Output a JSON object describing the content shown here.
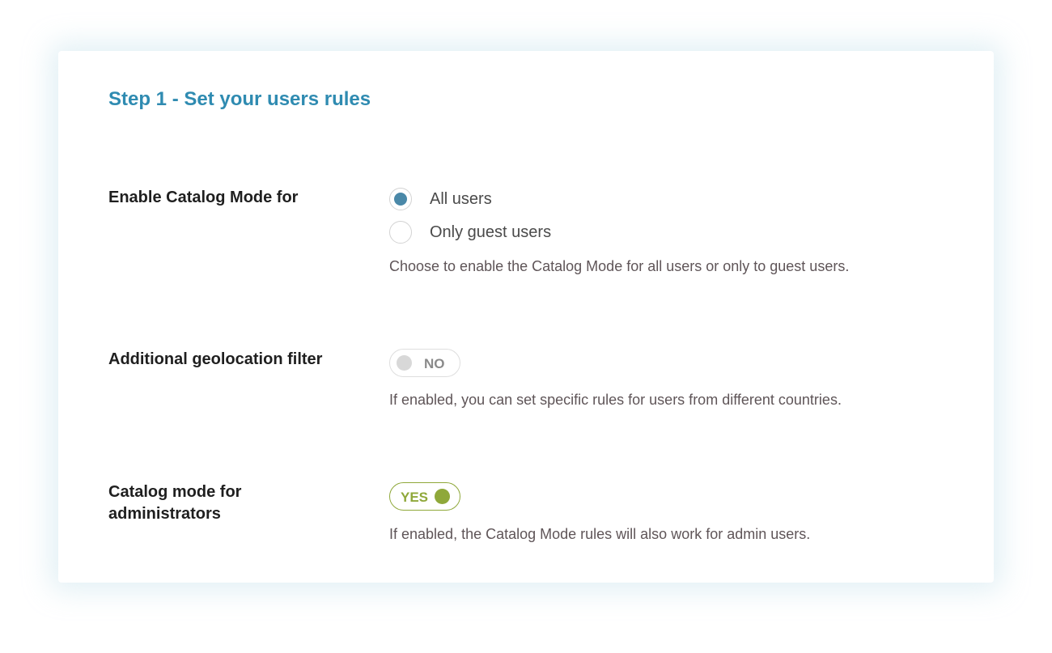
{
  "section": {
    "title": "Step 1 - Set your users rules"
  },
  "rows": {
    "catalog_mode_for": {
      "label": "Enable Catalog Mode for",
      "options": [
        {
          "label": "All users",
          "checked": true
        },
        {
          "label": "Only guest users",
          "checked": false
        }
      ],
      "help": "Choose to enable the Catalog Mode for all users or only to guest users."
    },
    "geolocation": {
      "label": "Additional geolocation filter",
      "toggle_state": "NO",
      "enabled": false,
      "help": "If enabled, you can set specific rules for users from different countries."
    },
    "administrators": {
      "label_line1": "Catalog mode for",
      "label_line2": "administrators",
      "toggle_state": "YES",
      "enabled": true,
      "help": "If enabled, the Catalog Mode rules will also work for admin users."
    }
  },
  "colors": {
    "title": "#2f8bb1",
    "radio_selected": "#4a88a8",
    "toggle_on": "#8fa83a",
    "toggle_off_knob": "#d8d8d8"
  }
}
